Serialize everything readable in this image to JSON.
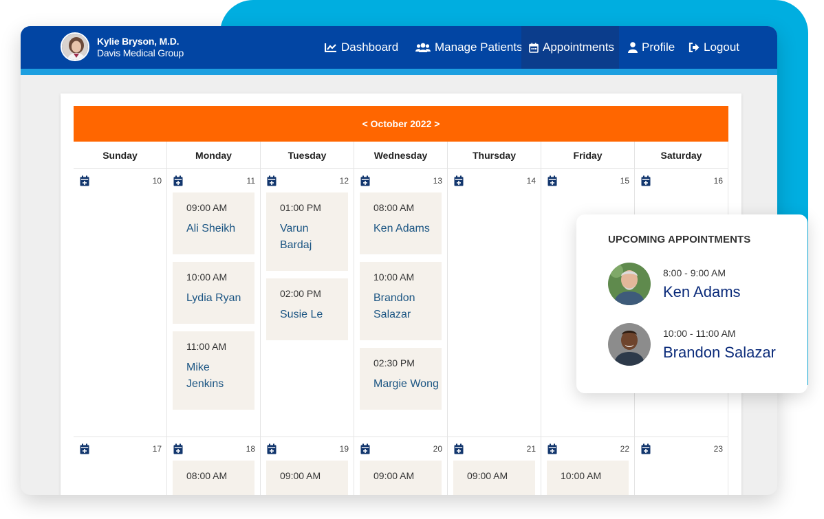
{
  "header": {
    "user_name": "Kylie Bryson, M.D.",
    "user_org": "Davis Medical Group",
    "nav": [
      {
        "label": "Dashboard",
        "icon": "chart-line-icon"
      },
      {
        "label": "Manage Patients",
        "icon": "users-icon"
      },
      {
        "label": "Appointments",
        "icon": "calendar-icon",
        "active": true
      },
      {
        "label": "Profile",
        "icon": "user-icon"
      },
      {
        "label": "Logout",
        "icon": "logout-icon"
      }
    ]
  },
  "calendar": {
    "month_label": "< October 2022 >",
    "days": [
      "Sunday",
      "Monday",
      "Tuesday",
      "Wednesday",
      "Thursday",
      "Friday",
      "Saturday"
    ],
    "weeks": [
      {
        "dates": [
          "10",
          "11",
          "12",
          "13",
          "14",
          "15",
          "16"
        ],
        "appointments": [
          [],
          [
            {
              "time": "09:00 AM",
              "name": "Ali Sheikh"
            },
            {
              "time": "10:00 AM",
              "name": "Lydia Ryan"
            },
            {
              "time": "11:00 AM",
              "name": "Mike Jenkins"
            }
          ],
          [
            {
              "time": "01:00 PM",
              "name": "Varun Bardaj"
            },
            {
              "time": "02:00 PM",
              "name": "Susie Le"
            }
          ],
          [
            {
              "time": "08:00 AM",
              "name": "Ken Adams"
            },
            {
              "time": "10:00 AM",
              "name": "Brandon Salazar"
            },
            {
              "time": "02:30 PM",
              "name": "Margie Wong"
            }
          ],
          [],
          [],
          []
        ]
      },
      {
        "dates": [
          "17",
          "18",
          "19",
          "20",
          "21",
          "22",
          "23"
        ],
        "appointments": [
          [],
          [
            {
              "time": "08:00 AM",
              "name": ""
            }
          ],
          [
            {
              "time": "09:00 AM",
              "name": ""
            }
          ],
          [
            {
              "time": "09:00 AM",
              "name": ""
            }
          ],
          [
            {
              "time": "09:00 AM",
              "name": ""
            }
          ],
          [
            {
              "time": "10:00 AM",
              "name": ""
            }
          ],
          []
        ]
      }
    ]
  },
  "upcoming": {
    "title": "UPCOMING APPOINTMENTS",
    "items": [
      {
        "time": "8:00 - 9:00 AM",
        "name": "Ken Adams"
      },
      {
        "time": "10:00 - 11:00 AM",
        "name": "Brandon Salazar"
      }
    ]
  },
  "colors": {
    "header_bg": "#0245a3",
    "header_stripe": "#1d9fe0",
    "month_bar": "#ff6600",
    "backdrop": "#00aee0",
    "appointment_bg": "#f5f1eb",
    "appointment_name": "#1b5583",
    "upcoming_name": "#0b2b7a"
  }
}
